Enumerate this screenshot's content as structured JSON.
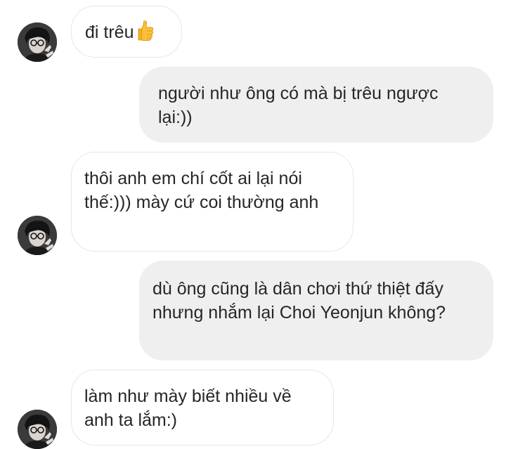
{
  "messages": [
    {
      "from": "them",
      "text": "đi trêu",
      "emoji": "thumbs-up-icon"
    },
    {
      "from": "me",
      "text": "người như ông có mà bị trêu ngược lại:))"
    },
    {
      "from": "them",
      "text": "thôi anh em chí cốt ai lại nói thế:))) mày cứ coi thường anh"
    },
    {
      "from": "me",
      "text": "dù ông cũng là dân chơi thứ thiệt đấy nhưng nhắm lại Choi Yeonjun không?"
    },
    {
      "from": "them",
      "text": "làm như mày biết nhiều về anh ta lắm:)"
    }
  ],
  "colors": {
    "incoming_bg": "#ffffff",
    "incoming_border": "#e6e6e6",
    "outgoing_bg": "#efefef",
    "text": "#262626"
  }
}
